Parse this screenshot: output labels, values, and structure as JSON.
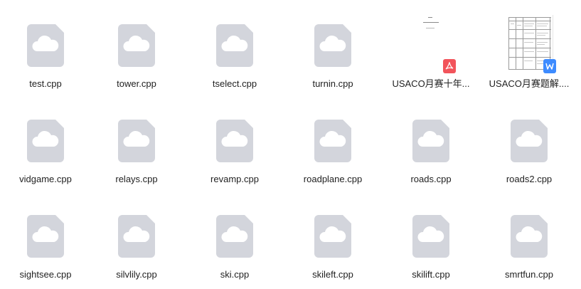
{
  "files": [
    {
      "name": "test.cpp",
      "type": "cloud-file-icon"
    },
    {
      "name": "tower.cpp",
      "type": "cloud-file-icon"
    },
    {
      "name": "tselect.cpp",
      "type": "cloud-file-icon"
    },
    {
      "name": "turnin.cpp",
      "type": "cloud-file-icon"
    },
    {
      "name": "USACO月赛十年...",
      "type": "pdf-icon"
    },
    {
      "name": "USACO月赛题解....",
      "type": "word-icon"
    },
    {
      "name": "vidgame.cpp",
      "type": "cloud-file-icon"
    },
    {
      "name": "relays.cpp",
      "type": "cloud-file-icon"
    },
    {
      "name": "revamp.cpp",
      "type": "cloud-file-icon"
    },
    {
      "name": "roadplane.cpp",
      "type": "cloud-file-icon"
    },
    {
      "name": "roads.cpp",
      "type": "cloud-file-icon"
    },
    {
      "name": "roads2.cpp",
      "type": "cloud-file-icon"
    },
    {
      "name": "sightsee.cpp",
      "type": "cloud-file-icon"
    },
    {
      "name": "silvlily.cpp",
      "type": "cloud-file-icon"
    },
    {
      "name": "ski.cpp",
      "type": "cloud-file-icon"
    },
    {
      "name": "skileft.cpp",
      "type": "cloud-file-icon"
    },
    {
      "name": "skilift.cpp",
      "type": "cloud-file-icon"
    },
    {
      "name": "smrtfun.cpp",
      "type": "cloud-file-icon"
    }
  ],
  "colors": {
    "icon_fill": "#d3d5dc",
    "cloud": "#ffffff",
    "pdf_badge": "#f2545b",
    "word_badge": "#3d8bff"
  }
}
